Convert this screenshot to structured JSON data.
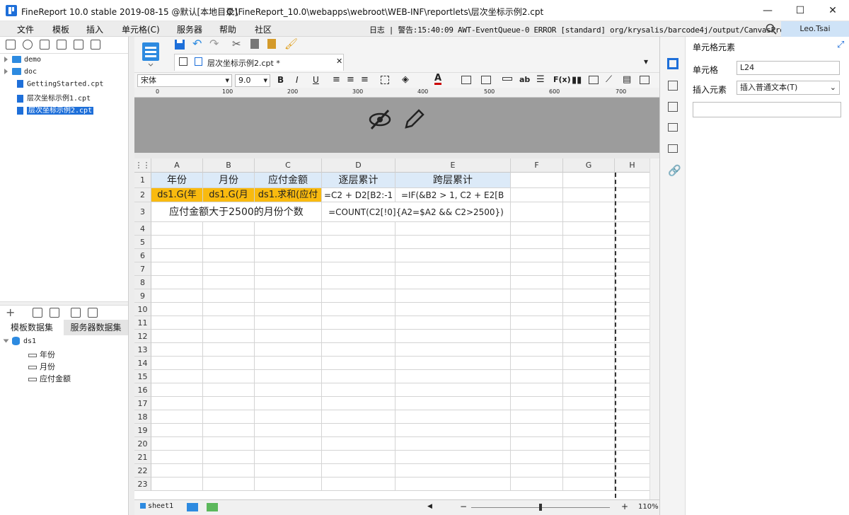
{
  "titlebar": {
    "title": "FineReport 10.0 stable 2019-08-15 @默认[本地目录]",
    "path": "C:\\FineReport_10.0\\webapps\\webroot\\WEB-INF\\reportlets\\层次坐标示例2.cpt",
    "minimize": "—",
    "maximize": "☐",
    "close": "✕"
  },
  "menu": {
    "items": [
      "文件",
      "模板",
      "插入",
      "单元格(C)",
      "服务器",
      "帮助",
      "社区"
    ],
    "log": "日志 | 警告:15:40:09 AWT-EventQueue-0 ERROR [standard] org/krysalis/barcode4j/output/CanvasProvider",
    "user": "Leo.Tsai"
  },
  "tree": {
    "items": [
      {
        "label": "demo",
        "type": "folder"
      },
      {
        "label": "doc",
        "type": "folder"
      },
      {
        "label": "GettingStarted.cpt",
        "type": "file"
      },
      {
        "label": "层次坐标示例1.cpt",
        "type": "file"
      },
      {
        "label": "层次坐标示例2.cpt",
        "type": "file",
        "selected": true
      }
    ]
  },
  "datasets": {
    "tabs": [
      "模板数据集",
      "服务器数据集"
    ],
    "ds": "ds1",
    "fields": [
      "年份",
      "月份",
      "应付金额"
    ]
  },
  "editor": {
    "tab_label": "层次坐标示例2.cpt *",
    "font_name": "宋体",
    "font_size": "9.0",
    "ruler_ticks": [
      "0",
      "100",
      "200",
      "300",
      "400",
      "500",
      "600",
      "700"
    ],
    "columns": [
      "A",
      "B",
      "C",
      "D",
      "E",
      "F",
      "G",
      "H"
    ],
    "rows": [
      "1",
      "2",
      "3",
      "4",
      "5",
      "6",
      "7",
      "8",
      "9",
      "10",
      "11",
      "12",
      "13",
      "14",
      "15",
      "16",
      "17",
      "18",
      "19",
      "20",
      "21",
      "22",
      "23"
    ],
    "cells": {
      "A1": "年份",
      "B1": "月份",
      "C1": "应付金额",
      "D1": "逐层累计",
      "E1": "跨层累计",
      "A2": "ds1.G(年",
      "B2": "ds1.G(月",
      "C2": "ds1.求和(应付",
      "D2": "=C2 + D2[B2:-1",
      "E2": "=IF(&B2 > 1, C2 + E2[B",
      "A3": "应付金额大于2500的月份个数",
      "D3": "=COUNT(C2[!0]{A2=$A2 && C2>2500})"
    },
    "sheet": "sheet1",
    "zoom": "110%"
  },
  "rightpanel": {
    "title": "单元格元素",
    "cell_label": "单元格",
    "cell_value": "L24",
    "insert_label": "插入元素",
    "insert_value": "插入普通文本(T)"
  },
  "colors": {
    "accent": "#1e6fd9",
    "header_fill": "#dceaf8",
    "yellow_fill": "#f9ba0f"
  }
}
